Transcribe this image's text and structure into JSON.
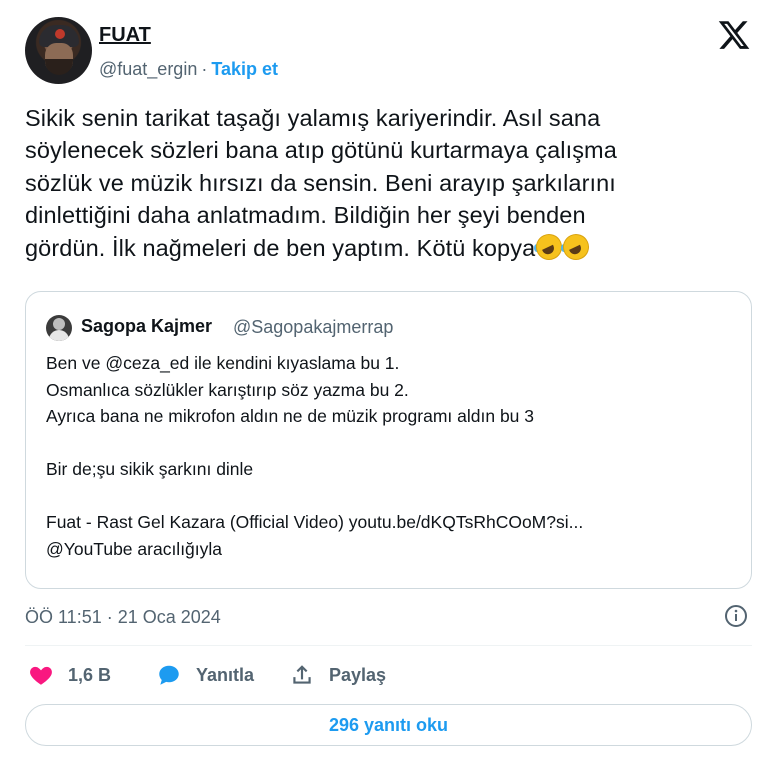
{
  "author": {
    "name": "FUAT",
    "handle": "@fuat_ergin",
    "separator": "·",
    "follow_label": "Takip et"
  },
  "tweet": {
    "lines": [
      "Sikik senin tarikat taşağı yalamış kariyerindir. Asıl sana",
      "söylenecek sözleri bana atıp götünü kurtarmaya çalışma",
      "sözlük ve müzik hırsızı da sensin. Beni arayıp şarkılarını",
      "dinlettiğini daha anlatmadım. Bildiğin her şeyi benden",
      "gördün. İlk nağmeleri de ben yaptım. Kötü kopya"
    ],
    "emoji_icons": [
      "rolling-on-floor-laughing-icon",
      "rolling-on-floor-laughing-icon"
    ]
  },
  "quoted": {
    "name": "Sagopa Kajmer",
    "handle": "@Sagopakajmerrap",
    "lines": [
      "Ben ve @ceza_ed  ile kendini kıyaslama bu 1.",
      "Osmanlıca sözlükler karıştırıp söz yazma bu 2.",
      "Ayrıca bana ne mikrofon aldın ne de müzik programı aldın bu 3",
      "",
      "Bir de;şu sikik şarkını dinle",
      "",
      "Fuat - Rast Gel Kazara (Official Video) youtu.be/dKQTsRhCOoM?si...",
      "@YouTube aracılığıyla"
    ]
  },
  "meta": {
    "timestamp": "ÖÖ 11:51 · 21 Oca 2024"
  },
  "actions": {
    "likes": "1,6 B",
    "reply_label": "Yanıtla",
    "share_label": "Paylaş",
    "read_replies": "296 yanıtı oku"
  },
  "colors": {
    "accent": "#1d9bf0",
    "like": "#f91880",
    "muted": "#536471",
    "border": "#cfd9de"
  }
}
